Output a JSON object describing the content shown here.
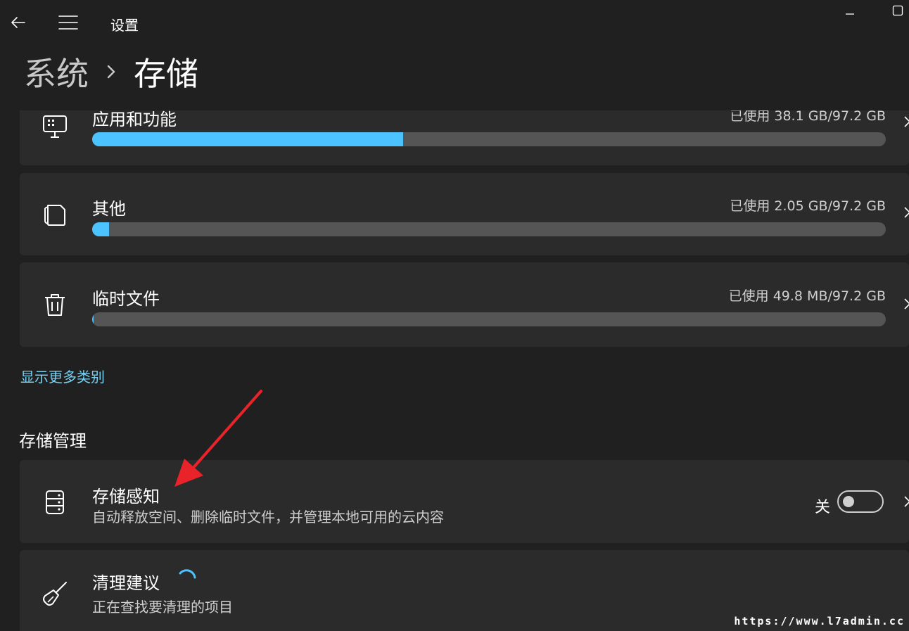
{
  "titlebar": {
    "back_icon": "back-arrow-icon",
    "menu_icon": "hamburger-menu-icon",
    "app_title": "设置",
    "minimize_icon": "minimize-icon",
    "maximize_icon": "maximize-icon"
  },
  "breadcrumb": {
    "parent": "系统",
    "separator_icon": "chevron-right-icon",
    "current": "存储"
  },
  "storage_categories": [
    {
      "title": "应用和功能",
      "usage": "已使用 38.1 GB/97.2 GB",
      "fraction": 0.392,
      "icon": "apps-icon"
    },
    {
      "title": "其他",
      "usage": "已使用 2.05 GB/97.2 GB",
      "fraction": 0.021,
      "icon": "documents-icon"
    },
    {
      "title": "临时文件",
      "usage": "已使用 49.8 MB/97.2 GB",
      "fraction": 0.0005,
      "icon": "trash-icon"
    }
  ],
  "show_more_link": "显示更多类别",
  "storage_management": {
    "section_title": "存储管理",
    "storage_sense": {
      "title": "存储感知",
      "description": "自动释放空间、删除临时文件，并管理本地可用的云内容",
      "toggle_state": "关",
      "toggle_on": false,
      "icon": "drive-icon"
    },
    "cleanup": {
      "title": "清理建议",
      "description": "正在查找要清理的项目",
      "icon": "broom-icon",
      "loading_icon": "spinner-icon"
    }
  },
  "colors": {
    "accent": "#4cc2ff",
    "background": "#202020",
    "card": "#2b2b2b",
    "link": "#78d0f2",
    "annotation_arrow": "#e8232a"
  },
  "watermark": "https://www.l7admin.cc"
}
